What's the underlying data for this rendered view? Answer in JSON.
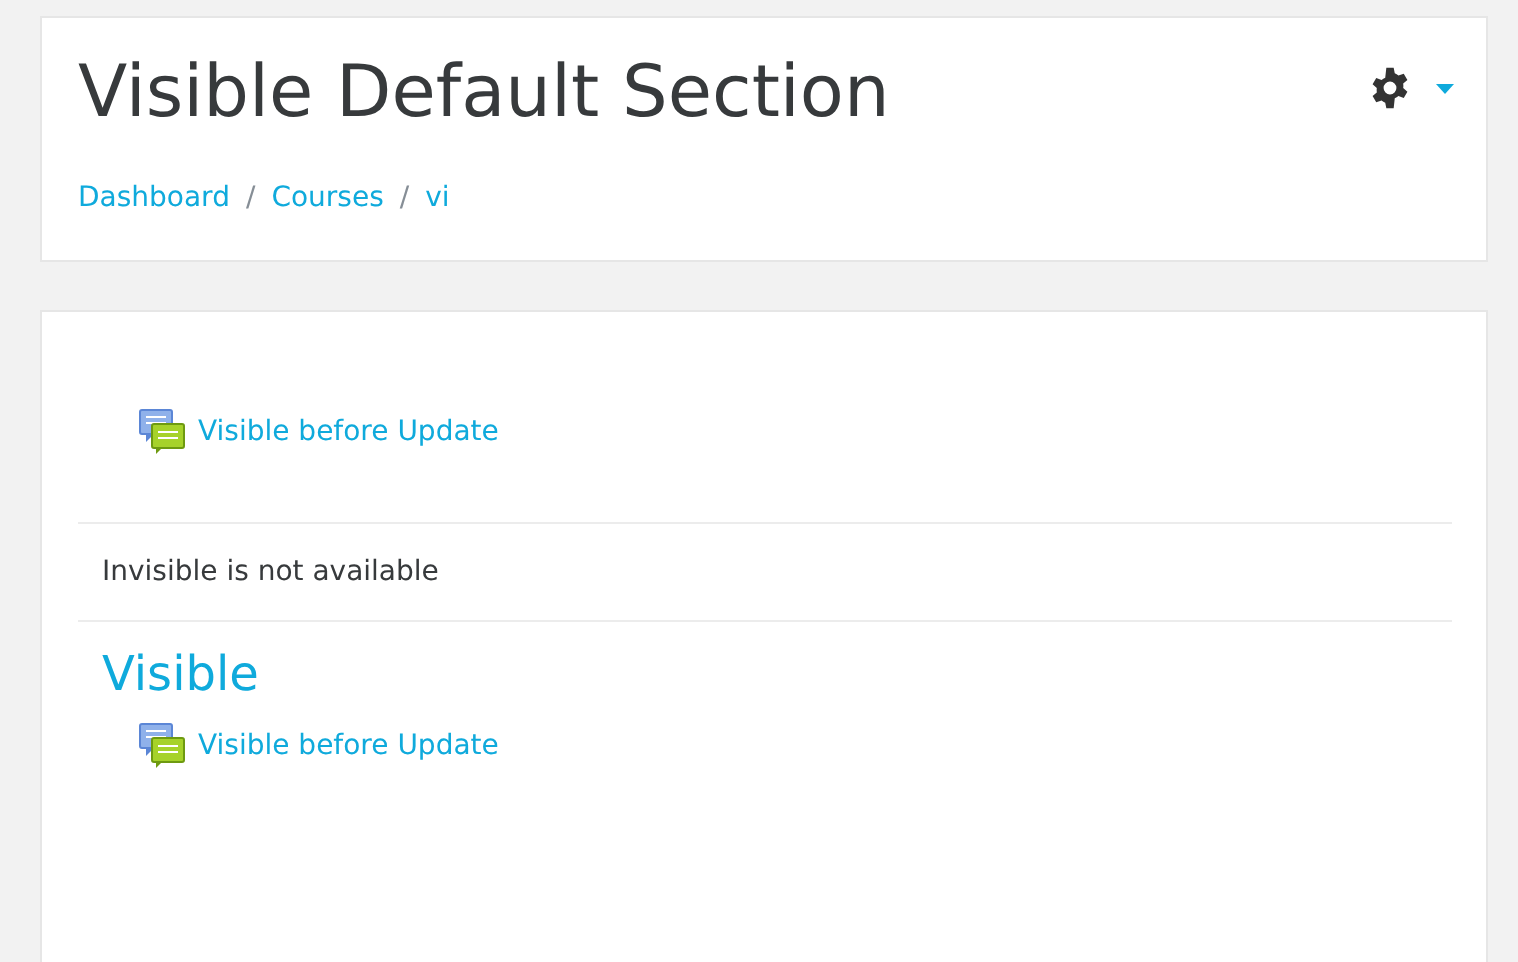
{
  "header": {
    "title": "Visible Default Section",
    "breadcrumb": [
      "Dashboard",
      "Courses",
      "vi"
    ],
    "separator": "/"
  },
  "sections": [
    {
      "kind": "activities",
      "activities": [
        "Visible before Update"
      ]
    },
    {
      "kind": "notice",
      "text": "Invisible is not available"
    },
    {
      "kind": "titled",
      "title": "Visible",
      "activities": [
        "Visible before Update"
      ]
    }
  ]
}
